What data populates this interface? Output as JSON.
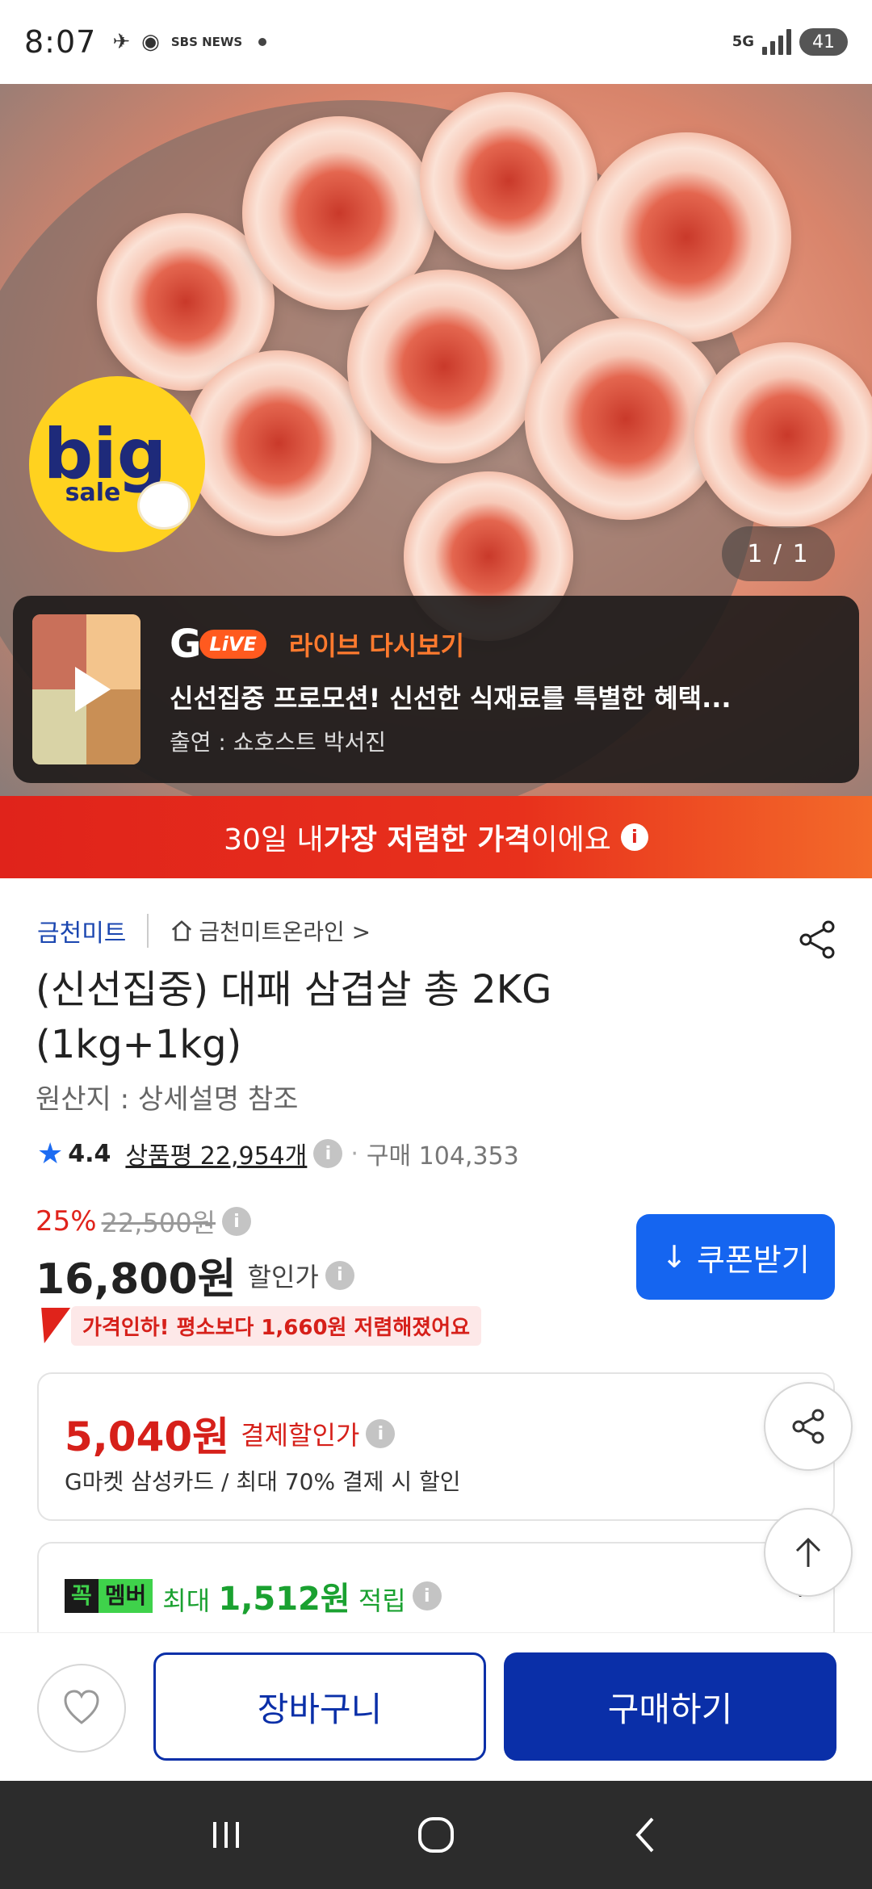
{
  "status_bar": {
    "time": "8:07",
    "news_badge": "SBS NEWS",
    "network": "5G",
    "battery": "41"
  },
  "hero": {
    "badge_big": "big",
    "badge_sale": "sale",
    "page_indicator": "1 / 1"
  },
  "live": {
    "g_logo": "G",
    "live_pill": "LiVE",
    "label": "라이브 다시보기",
    "title": "신선집중 프로모션! 신선한 식재료를 특별한 혜택...",
    "host": "출연 : 쇼호스트 박서진"
  },
  "price_banner": {
    "pre": "30일 내 ",
    "bold": "가장 저렴한 가격",
    "post": "이에요",
    "info": "i"
  },
  "seller": {
    "name": "금천미트",
    "store": "금천미트온라인 >"
  },
  "product": {
    "title": "(신선집중) 대패 삼겹살 총 2KG (1kg+1kg)",
    "origin": "원산지 : 상세설명 참조"
  },
  "rating": {
    "score": "4.4",
    "reviews": "상품평 22,954개",
    "purchases": "구매 104,353"
  },
  "price": {
    "discount_rate": "25%",
    "original": "22,500원",
    "sale": "16,800원",
    "sale_label": "할인가",
    "coupon_button": "쿠폰받기",
    "pricedown": "가격인하! 평소보다 1,660원 저렴해졌어요"
  },
  "card_payment": {
    "amount": "5,040원",
    "label": "결제할인가",
    "desc": "G마켓 삼성카드 / 최대 70% 결제 시 할인"
  },
  "membership": {
    "badge_1": "꼭",
    "badge_2": "멤버",
    "pre": "최대 ",
    "amount": "1,512원",
    "post": " 적립"
  },
  "bottom": {
    "cart": "장바구니",
    "buy": "구매하기"
  },
  "colors": {
    "accent_blue": "#1565f0",
    "buy_navy": "#0a2fa8",
    "sale_red": "#e0231b",
    "member_green": "#3fd24b"
  }
}
